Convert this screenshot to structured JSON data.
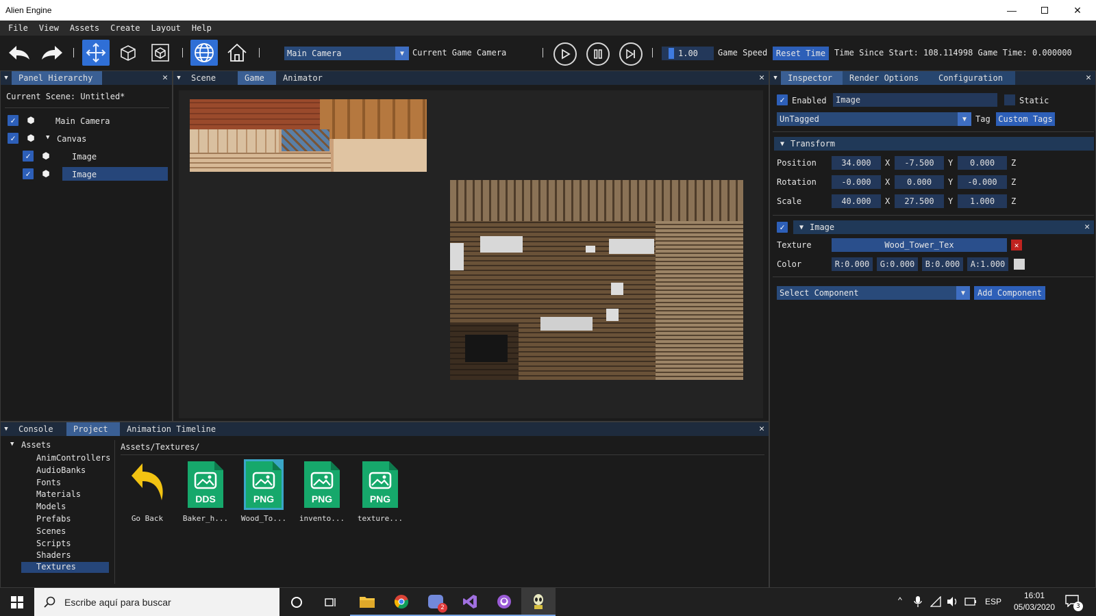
{
  "window": {
    "title": "Alien Engine"
  },
  "menu": [
    "File",
    "View",
    "Assets",
    "Create",
    "Layout",
    "Help"
  ],
  "toolbar": {
    "camera_select": "Main Camera",
    "camera_label": "Current Game Camera",
    "speed_value": "1.00",
    "speed_label": "Game Speed",
    "reset_time": "Reset Time",
    "time_info": "Time Since Start: 108.114998 Game Time: 0.000000"
  },
  "hierarchy": {
    "tab": "Panel Hierarchy",
    "scene": "Current Scene: Untitled*",
    "items": [
      "Main Camera",
      "Canvas",
      "Image",
      "Image"
    ]
  },
  "viewport": {
    "tabs": [
      "Scene",
      "Game",
      "Animator"
    ]
  },
  "inspector": {
    "tabs": [
      "Inspector",
      "Render Options",
      "Configuration"
    ],
    "enabled_label": "Enabled",
    "name_value": "Image",
    "static_label": "Static",
    "tag_value": "UnTagged",
    "tag_label": "Tag",
    "custom_tags": "Custom Tags",
    "transform": {
      "title": "Transform",
      "rows": [
        {
          "label": "Position",
          "x": "34.000",
          "y": "-7.500",
          "z": "0.000"
        },
        {
          "label": "Rotation",
          "x": "-0.000",
          "y": "0.000",
          "z": "-0.000"
        },
        {
          "label": "Scale",
          "x": "40.000",
          "y": "27.500",
          "z": "1.000"
        }
      ],
      "axis_x": "X",
      "axis_y": "Y",
      "axis_z": "Z"
    },
    "image": {
      "title": "Image",
      "texture_label": "Texture",
      "texture_value": "Wood_Tower_Tex",
      "color_label": "Color",
      "r": "R:0.000",
      "g": "G:0.000",
      "b": "B:0.000",
      "a": "A:1.000"
    },
    "select_component": "Select Component",
    "add_component": "Add Component"
  },
  "bottom": {
    "tabs": [
      "Console",
      "Project",
      "Animation Timeline"
    ],
    "tree_root": "Assets",
    "folders": [
      "AnimControllers",
      "AudioBanks",
      "Fonts",
      "Materials",
      "Models",
      "Prefabs",
      "Scenes",
      "Scripts",
      "Shaders",
      "Textures"
    ],
    "path": "Assets/Textures/",
    "files": [
      {
        "name": "Go Back"
      },
      {
        "name": "Baker_h...",
        "ext": "DDS"
      },
      {
        "name": "Wood_To...",
        "ext": "PNG"
      },
      {
        "name": "invento...",
        "ext": "PNG"
      },
      {
        "name": "texture...",
        "ext": "PNG"
      }
    ]
  },
  "taskbar": {
    "search_placeholder": "Escribe aquí para buscar",
    "lang": "ESP",
    "time": "16:01",
    "date": "05/03/2020",
    "notif_badge": "3",
    "discord_badge": "2"
  },
  "colors": {
    "accent": "#2f6fd6",
    "panel_bg": "#1b1b1b",
    "tab_active": "#3a5f94",
    "remove": "#c0231f"
  }
}
